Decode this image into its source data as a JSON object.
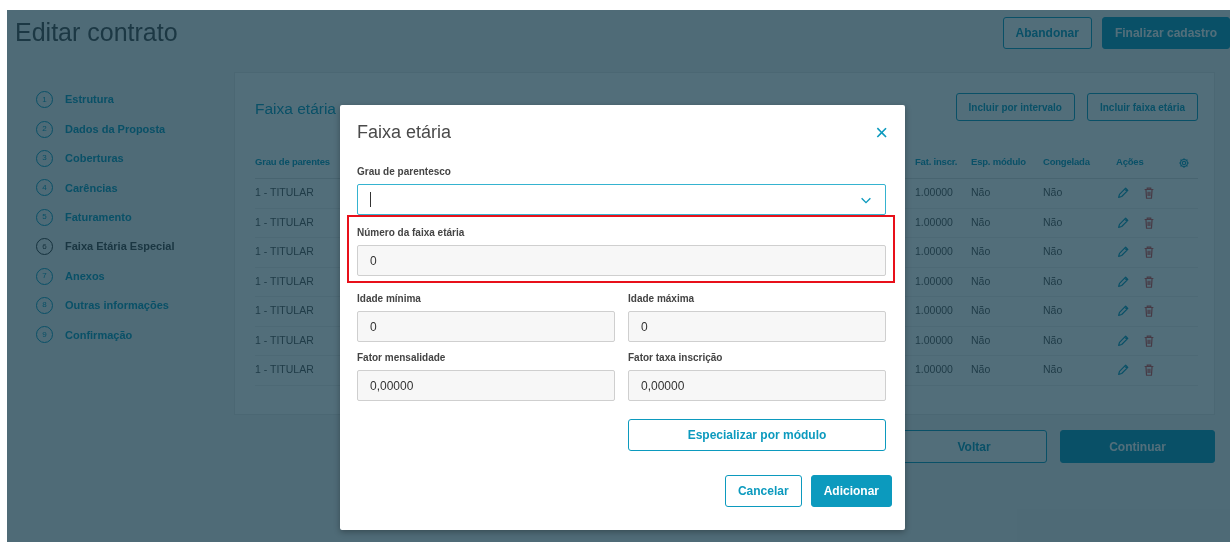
{
  "page": {
    "title": "Editar contrato",
    "header_buttons": [
      {
        "label": "Abandonar",
        "kind": "outline"
      },
      {
        "label": "Finalizar cadastro",
        "kind": "primary"
      }
    ]
  },
  "steps": [
    {
      "number": "1",
      "label": "Estrutura",
      "selected": false
    },
    {
      "number": "2",
      "label": "Dados da Proposta",
      "selected": false
    },
    {
      "number": "3",
      "label": "Coberturas",
      "selected": false
    },
    {
      "number": "4",
      "label": "Carências",
      "selected": false
    },
    {
      "number": "5",
      "label": "Faturamento",
      "selected": false
    },
    {
      "number": "6",
      "label": "Faixa Etária Especial",
      "selected": true
    },
    {
      "number": "7",
      "label": "Anexos",
      "selected": false
    },
    {
      "number": "8",
      "label": "Outras informações",
      "selected": false
    },
    {
      "number": "9",
      "label": "Confirmação",
      "selected": false
    }
  ],
  "card": {
    "title": "Faixa etária",
    "actions": [
      {
        "label": "Incluir por intervalo"
      },
      {
        "label": "Incluir faixa etária"
      }
    ],
    "table": {
      "columns": [
        "Grau de parentes",
        "Fat. inscr.",
        "Esp. módulo",
        "Congelada",
        "Ações"
      ],
      "rows": [
        {
          "cells": [
            "1 - TITULAR",
            "1.00000",
            "Não",
            "Não"
          ]
        },
        {
          "cells": [
            "1 - TITULAR",
            "1.00000",
            "Não",
            "Não"
          ]
        },
        {
          "cells": [
            "1 - TITULAR",
            "1.00000",
            "Não",
            "Não"
          ]
        },
        {
          "cells": [
            "1 - TITULAR",
            "1.00000",
            "Não",
            "Não"
          ]
        },
        {
          "cells": [
            "1 - TITULAR",
            "1.00000",
            "Não",
            "Não"
          ]
        },
        {
          "cells": [
            "1 - TITULAR",
            "1.00000",
            "Não",
            "Não"
          ]
        },
        {
          "cells": [
            "1 - TITULAR",
            "1.00000",
            "Não",
            "Não"
          ]
        }
      ]
    }
  },
  "footer_buttons": [
    {
      "label": "Voltar",
      "kind": "outline"
    },
    {
      "label": "Continuar",
      "kind": "primary"
    }
  ],
  "modal": {
    "title": "Faixa etária",
    "close": "×",
    "field_rows": [
      [
        {
          "label": "Grau de parentesco",
          "kind": "select",
          "focused": true,
          "highlighted": false
        }
      ],
      [
        {
          "label": "Número da faixa etária",
          "kind": "text",
          "value": "0",
          "focused": false,
          "highlighted": true
        }
      ],
      [
        {
          "label": "Idade mínima",
          "kind": "text",
          "value": "0",
          "focused": false,
          "highlighted": false
        },
        {
          "label": "Idade máxima",
          "kind": "text",
          "value": "0",
          "focused": false,
          "highlighted": false
        }
      ],
      [
        {
          "label": "Fator mensalidade",
          "kind": "text",
          "value": "0,00000",
          "focused": false,
          "highlighted": false
        },
        {
          "label": "Fator taxa inscrição",
          "kind": "text",
          "value": "0,00000",
          "focused": false,
          "highlighted": false
        }
      ]
    ],
    "extra_button": {
      "label": "Especializar por módulo",
      "kind": "outline"
    },
    "buttons": [
      {
        "label": "Cancelar",
        "kind": "outline"
      },
      {
        "label": "Adicionar",
        "kind": "primary"
      }
    ]
  }
}
